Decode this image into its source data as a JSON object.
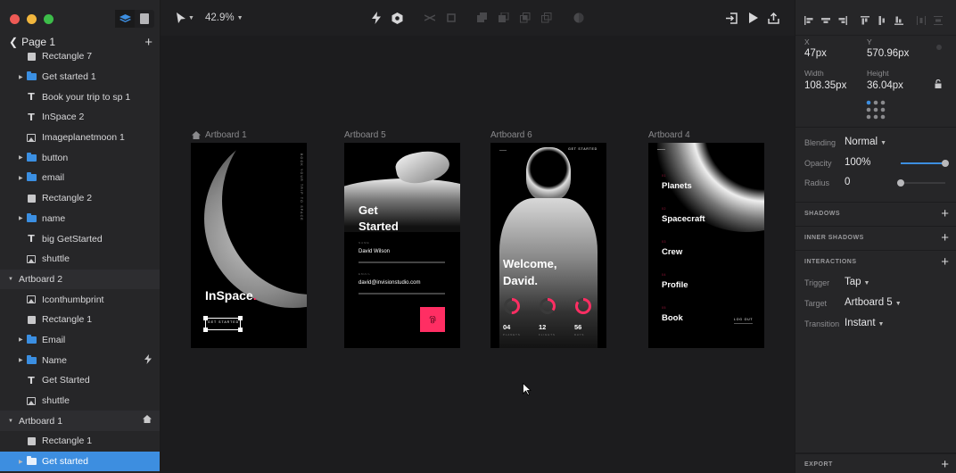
{
  "sidebar": {
    "page_title": "Page 1",
    "layers": [
      {
        "name": "Rectangle 7",
        "icon": "rectangle-icon",
        "level": 2,
        "expandable": false
      },
      {
        "name": "Get started 1",
        "icon": "folder-icon",
        "level": 2,
        "expandable": true
      },
      {
        "name": "Book your trip to sp 1",
        "icon": "text-icon",
        "level": 2,
        "expandable": false
      },
      {
        "name": "InSpace 2",
        "icon": "text-icon",
        "level": 2,
        "expandable": false
      },
      {
        "name": "Imageplanetmoon 1",
        "icon": "image-icon",
        "level": 2,
        "expandable": false
      },
      {
        "name": "button",
        "icon": "folder-icon",
        "level": 2,
        "expandable": true
      },
      {
        "name": "email",
        "icon": "folder-icon",
        "level": 2,
        "expandable": true
      },
      {
        "name": "Rectangle 2",
        "icon": "rectangle-icon",
        "level": 2,
        "expandable": false
      },
      {
        "name": "name",
        "icon": "folder-icon",
        "level": 2,
        "expandable": true
      },
      {
        "name": "big GetStarted",
        "icon": "text-icon",
        "level": 2,
        "expandable": false
      },
      {
        "name": "shuttle",
        "icon": "image-icon",
        "level": 2,
        "expandable": false
      },
      {
        "name": "Artboard 2",
        "icon": "",
        "level": 1,
        "expandable": true
      },
      {
        "name": "Iconthumbprint",
        "icon": "image-icon",
        "level": 2,
        "expandable": false
      },
      {
        "name": "Rectangle 1",
        "icon": "rectangle-icon",
        "level": 2,
        "expandable": false
      },
      {
        "name": "Email",
        "icon": "folder-icon",
        "level": 2,
        "expandable": true
      },
      {
        "name": "Name",
        "icon": "folder-icon",
        "level": 2,
        "expandable": true,
        "badge": "lightning-icon"
      },
      {
        "name": "Get Started",
        "icon": "text-icon",
        "level": 2,
        "expandable": false
      },
      {
        "name": "shuttle",
        "icon": "image-icon",
        "level": 2,
        "expandable": false
      },
      {
        "name": "Artboard 1",
        "icon": "",
        "level": 1,
        "expandable": true,
        "badge": "home-icon"
      },
      {
        "name": "Rectangle 1",
        "icon": "rectangle-icon",
        "level": 2,
        "expandable": false
      },
      {
        "name": "Get started",
        "icon": "folder-icon",
        "level": 2,
        "expandable": true,
        "selected": true
      }
    ]
  },
  "toolbar": {
    "zoom": "42.9%"
  },
  "canvas": {
    "artboards": {
      "a1": {
        "label": "Artboard 1",
        "title": "InSpace",
        "dot": ".",
        "vertical_text": "BOOK YOUR TRIP TO SPACE",
        "button": "GET STARTED"
      },
      "a5": {
        "label": "Artboard 5",
        "heading1": "Get",
        "heading2": "Started",
        "name_label": "NAME",
        "name_value": "David Wilson",
        "email_label": "EMAIL",
        "email_value": "david@invisionstudio.com"
      },
      "a6": {
        "label": "Artboard 6",
        "cta": "GET STARTED",
        "welcome1": "Welcome,",
        "welcome2": "David.",
        "stats": [
          {
            "value": "04",
            "label": "PLANETS",
            "progress": 0.5
          },
          {
            "value": "12",
            "label": "FLIGHTS",
            "progress": 0.35
          },
          {
            "value": "56",
            "label": "DAYS",
            "progress": 0.85
          }
        ]
      },
      "a4": {
        "label": "Artboard 4",
        "menu": [
          {
            "num": "01",
            "label": "Planets"
          },
          {
            "num": "02",
            "label": "Spacecraft"
          },
          {
            "num": "03",
            "label": "Crew"
          },
          {
            "num": "04",
            "label": "Profile"
          },
          {
            "num": "05",
            "label": "Book"
          }
        ],
        "logout": "LOG OUT"
      }
    }
  },
  "inspector": {
    "x_label": "X",
    "x_value": "47px",
    "y_label": "Y",
    "y_value": "570.96px",
    "w_label": "Width",
    "w_value": "108.35px",
    "h_label": "Height",
    "h_value": "36.04px",
    "blending_label": "Blending",
    "blending_value": "Normal",
    "opacity_label": "Opacity",
    "opacity_value": "100%",
    "opacity_fraction": 1.0,
    "radius_label": "Radius",
    "radius_value": "0",
    "radius_fraction": 0.0,
    "shadows": "SHADOWS",
    "inner_shadows": "INNER SHADOWS",
    "interactions": "INTERACTIONS",
    "trigger_label": "Trigger",
    "trigger_value": "Tap",
    "target_label": "Target",
    "target_value": "Artboard 5",
    "transition_label": "Transition",
    "transition_value": "Instant",
    "export": "EXPORT"
  },
  "colors": {
    "accent": "#3d8ee0",
    "pink": "#ff2e63"
  }
}
